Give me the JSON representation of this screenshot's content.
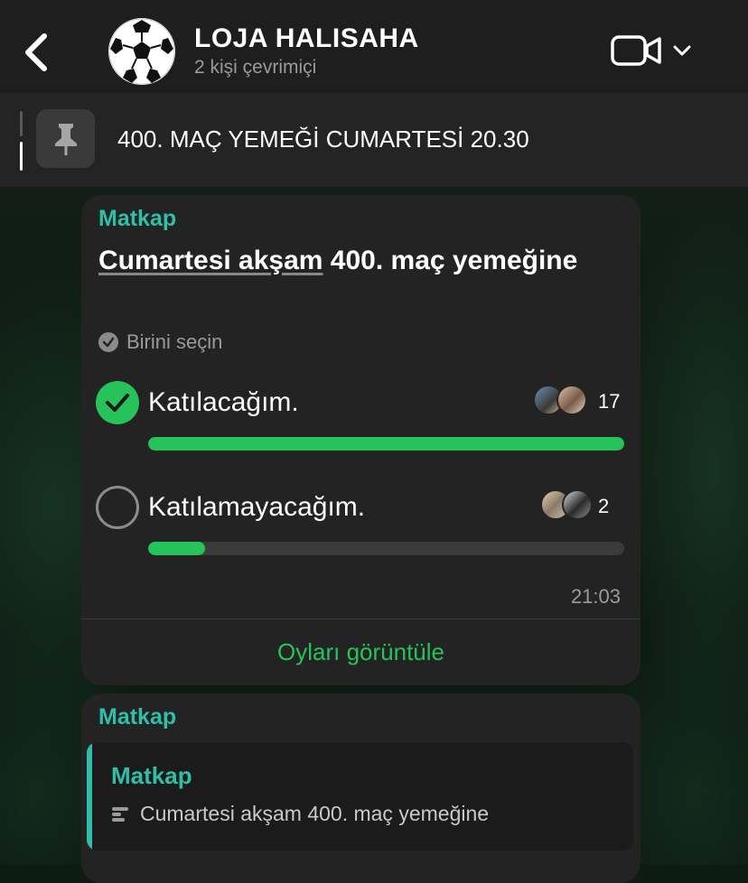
{
  "header": {
    "chat_name": "LOJA HALISAHA",
    "status": "2 kişi çevrimiçi",
    "avatar_icon": "soccer-ball-icon",
    "video_icon": "video-camera-icon"
  },
  "pinned": {
    "icon": "pin-icon",
    "text": "400. MAÇ YEMEĞİ CUMARTESİ 20.30"
  },
  "poll_message": {
    "sender": "Matkap",
    "question_underlined": "Cumartesi akşam",
    "question_rest": " 400. maç yemeğine",
    "hint": "Birini seçin",
    "options": [
      {
        "label": "Katılacağım.",
        "count": "17",
        "selected": true,
        "share": 1.0
      },
      {
        "label": "Katılamayacağım.",
        "count": "2",
        "selected": false,
        "share": 0.12
      }
    ],
    "time": "21:03",
    "view_votes_label": "Oyları görüntüle"
  },
  "reply_message": {
    "sender": "Matkap",
    "quoted_sender": "Matkap",
    "quoted_text": "Cumartesi akşam 400. maç yemeğine",
    "quoted_icon": "poll-icon"
  },
  "colors": {
    "accent_green": "#25c35a",
    "sender_teal": "#2fbfa6"
  }
}
